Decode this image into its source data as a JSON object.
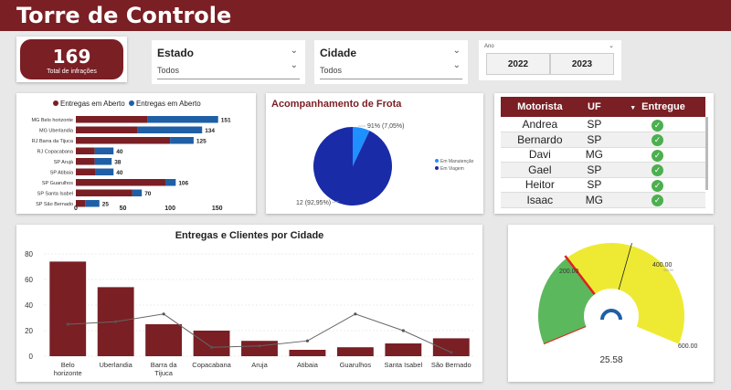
{
  "header": {
    "title": "Torre de Controle"
  },
  "kpi": {
    "value": "169",
    "label": "Total de infrações"
  },
  "filters": {
    "estado": {
      "label": "Estado",
      "value": "Todos"
    },
    "cidade": {
      "label": "Cidade",
      "value": "Todos"
    },
    "ano": {
      "label": "Ano",
      "options": [
        "2022",
        "2023"
      ]
    }
  },
  "bar_chart": {
    "legend": [
      "Entregas em Aberto",
      "Entregas em Aberto"
    ],
    "colors": [
      "#7a1f24",
      "#1f5fa6"
    ]
  },
  "frota": {
    "title": "Acompanhamento de Frota",
    "label_small": "91% (7,05%)",
    "label_large": "12 (92,95%)",
    "legend": [
      "Em Manutenção",
      "Em Viagem"
    ],
    "colors": [
      "#1e90ff",
      "#1a2ba8"
    ]
  },
  "motoristas": {
    "headers": [
      "Motorista",
      "UF",
      "Entregue"
    ],
    "rows": [
      {
        "name": "Andrea",
        "uf": "SP"
      },
      {
        "name": "Bernardo",
        "uf": "SP"
      },
      {
        "name": "Davi",
        "uf": "MG"
      },
      {
        "name": "Gael",
        "uf": "SP"
      },
      {
        "name": "Heitor",
        "uf": "SP"
      },
      {
        "name": "Isaac",
        "uf": "MG"
      }
    ]
  },
  "combo": {
    "title": "Entregas e Clientes por Cidade"
  },
  "gauge": {
    "value": 25.58,
    "value_label": "25.58",
    "labels": [
      "200.00",
      "400.00",
      "600.00"
    ],
    "sub_label": "400.00",
    "colors": {
      "green": "#5cb85c",
      "yellow": "#eeea34",
      "needle": "#1f5fa6",
      "red": "#e02020"
    }
  },
  "chart_data": [
    {
      "type": "bar",
      "orientation": "horizontal",
      "stacked": true,
      "categories": [
        "MG Belo horizonte",
        "MG Uberlandia",
        "RJ Barra da Tijuca",
        "RJ Copacabana",
        "SP Arujá",
        "SP Atibaia",
        "SP Guarulhos",
        "SP Santa Isabel",
        "SP São Bernado"
      ],
      "series": [
        {
          "name": "Entregas em Aberto",
          "values": [
            76,
            65,
            100,
            20,
            20,
            21,
            95,
            60,
            10
          ]
        },
        {
          "name": "Entregas em Aberto",
          "values": [
            75,
            69,
            25,
            20,
            18,
            19,
            11,
            10,
            15
          ]
        }
      ],
      "totals": [
        151,
        134,
        125,
        40,
        38,
        40,
        106,
        70,
        25
      ],
      "xticks": [
        0,
        50,
        100,
        150
      ],
      "xlim": [
        0,
        160
      ]
    },
    {
      "type": "pie",
      "slices": [
        {
          "name": "Em Manutenção",
          "value": 7.05
        },
        {
          "name": "Em Viagem",
          "value": 92.95
        }
      ]
    },
    {
      "type": "bar",
      "title": "Entregas e Clientes por Cidade",
      "categories": [
        "Belo horizonte",
        "Uberlandia",
        "Barra da Tijuca",
        "Copacabana",
        "Aruja",
        "Atibaia",
        "Guarulhos",
        "Santa Isabel",
        "São Bernado"
      ],
      "series": [
        {
          "values": [
            74,
            54,
            25,
            20,
            12,
            5,
            7,
            10,
            14
          ]
        },
        {
          "type": "line",
          "values": [
            25,
            27,
            33,
            7,
            8,
            12,
            33,
            20,
            3
          ]
        }
      ],
      "ylim": [
        0,
        80
      ],
      "yticks": [
        0,
        20,
        40,
        60,
        80
      ]
    }
  ]
}
